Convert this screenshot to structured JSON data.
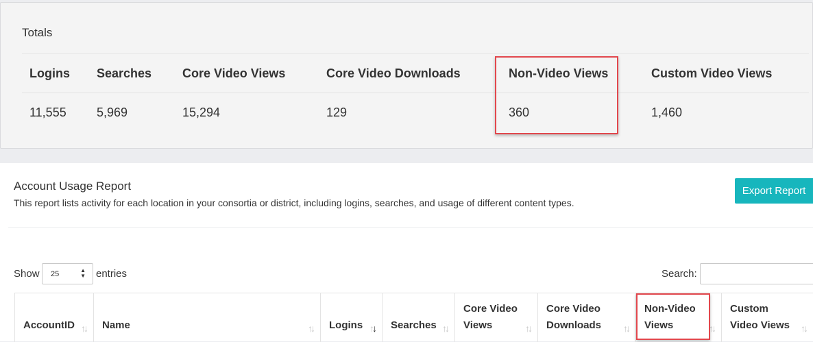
{
  "totals": {
    "title": "Totals",
    "columns": [
      "Logins",
      "Searches",
      "Core Video Views",
      "Core Video Downloads",
      "Non-Video Views",
      "Custom Video Views"
    ],
    "values": [
      "11,555",
      "5,969",
      "15,294",
      "129",
      "360",
      "1,460"
    ]
  },
  "report": {
    "title": "Account Usage Report",
    "description": "This report lists activity for each location in your consortia or district, including logins, searches, and usage of different content types.",
    "export_label": "Export Report"
  },
  "controls": {
    "show_label": "Show",
    "entries_value": "25",
    "entries_label": "entries",
    "search_label": "Search:",
    "search_value": ""
  },
  "table": {
    "headers": [
      [
        "AccountID"
      ],
      [
        "Name"
      ],
      [
        "Logins"
      ],
      [
        "Searches"
      ],
      [
        "Core Video",
        "Views"
      ],
      [
        "Core Video",
        "Downloads"
      ],
      [
        "Non-Video",
        "Views"
      ],
      [
        "Custom",
        "Video Views"
      ]
    ]
  },
  "colors": {
    "highlight": "#e2474d",
    "accent": "#17b6bd"
  }
}
